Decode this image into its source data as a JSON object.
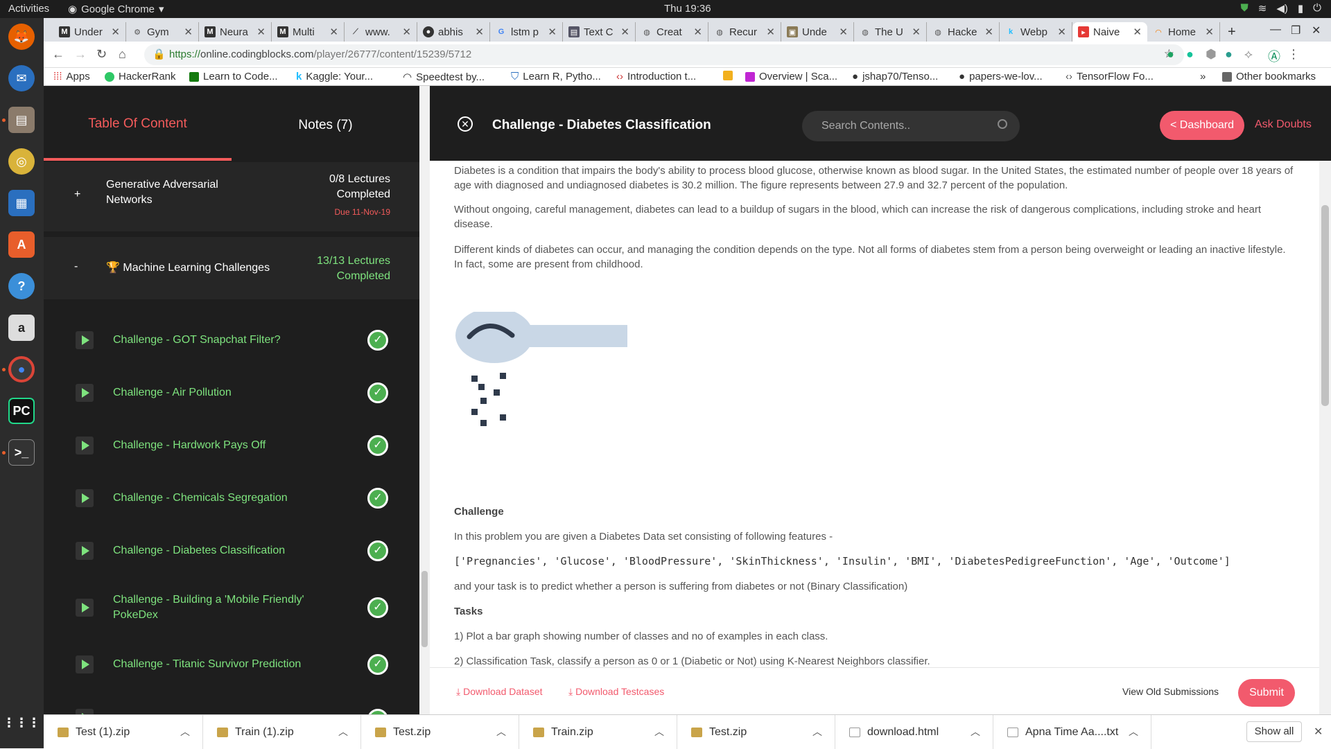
{
  "system": {
    "activities": "Activities",
    "app_name": "Google Chrome",
    "clock": "Thu 19:36"
  },
  "tabs": [
    {
      "label": "Under",
      "icon": "M"
    },
    {
      "label": "Gym",
      "icon": "gear"
    },
    {
      "label": "Neura",
      "icon": "M"
    },
    {
      "label": "Multi",
      "icon": "M"
    },
    {
      "label": "www.",
      "icon": "bolt"
    },
    {
      "label": "abhis",
      "icon": "github"
    },
    {
      "label": "lstm p",
      "icon": "G"
    },
    {
      "label": "Text C",
      "icon": "doc"
    },
    {
      "label": "Creat",
      "icon": "globe"
    },
    {
      "label": "Recur",
      "icon": "globe"
    },
    {
      "label": "Unde",
      "icon": "img"
    },
    {
      "label": "The U",
      "icon": "globe"
    },
    {
      "label": "Hacke",
      "icon": "globe"
    },
    {
      "label": "Webp",
      "icon": "k"
    },
    {
      "label": "Naive",
      "icon": "cb"
    },
    {
      "label": "Home",
      "icon": "c"
    }
  ],
  "url": {
    "scheme": "https://",
    "host": "online.codingblocks.com",
    "path": "/player/26777/content/15239/5712"
  },
  "bookmarks": [
    "Apps",
    "HackerRank",
    "Learn to Code...",
    "Kaggle: Your...",
    "Speedtest by...",
    "Learn R, Pytho...",
    "Introduction t...",
    "Overview | Sca...",
    "jshap70/Tenso...",
    "papers-we-lov...",
    "TensorFlow Fo...",
    "»",
    "Other bookmarks"
  ],
  "sidebar": {
    "toc_label": "Table Of Content",
    "notes_label": "Notes (7)",
    "sections": [
      {
        "sign": "+",
        "title": "Generative Adversarial Networks",
        "progress_line1": "0/8 Lectures",
        "progress_line2": "Completed",
        "due": "Due 11-Nov-19"
      },
      {
        "sign": "-",
        "title": "🏆 Machine Learning Challenges",
        "progress_line1": "13/13 Lectures",
        "progress_line2": "Completed"
      }
    ],
    "lectures": [
      "Challenge - GOT Snapchat Filter?",
      "Challenge - Air Pollution",
      "Challenge - Hardwork Pays Off",
      "Challenge - Chemicals Segregation",
      "Challenge - Diabetes Classification",
      "Challenge - Building a 'Mobile Friendly' PokeDex",
      "Challenge - Titanic Survivor Prediction"
    ]
  },
  "header": {
    "title": "Challenge - Diabetes Classification",
    "search_placeholder": "Search Contents..",
    "dashboard_label": "< Dashboard",
    "ask_label": "Ask Doubts"
  },
  "content": {
    "p1": "Diabetes is a condition that impairs the body's ability to process blood glucose, otherwise known as blood sugar. In the United States, the estimated number of people over 18 years of age with diagnosed and undiagnosed diabetes is 30.2 million. The figure represents between 27.9 and 32.7 percent of the population.",
    "p2": "Without ongoing, careful management, diabetes can lead to a buildup of sugars in the blood, which can increase the risk of dangerous complications, including stroke and heart disease.",
    "p3": "Different kinds of diabetes can occur, and managing the condition depends on the type. Not all forms of diabetes stem from a person being overweight or leading an inactive lifestyle. In fact, some are present from childhood.",
    "challenge_heading": "Challenge",
    "challenge_intro": "In this problem you are given a Diabetes Data set consisting of following features -",
    "features": "['Pregnancies', 'Glucose', 'BloodPressure', 'SkinThickness', 'Insulin', 'BMI', 'DiabetesPedigreeFunction', 'Age', 'Outcome']",
    "task_text": "and your task is to predict whether a person is suffering from diabetes or not (Binary Classification)",
    "tasks_heading": "Tasks",
    "task1": "1) Plot a bar graph showing number of classes and no of examples in each class.",
    "task2": "2) Classification Task, classify a person as 0 or 1 (Diabetic or Not) using K-Nearest Neighbors classifier."
  },
  "footer": {
    "download_dataset": "Download Dataset",
    "download_testcases": "Download Testcases",
    "old_submissions": "View Old Submissions",
    "submit": "Submit"
  },
  "downloads": {
    "items": [
      "Test (1).zip",
      "Train (1).zip",
      "Test.zip",
      "Train.zip",
      "Test.zip",
      "download.html",
      "Apna Time Aa....txt"
    ],
    "show_all": "Show all"
  },
  "colors": {
    "accent": "#f25a6d",
    "completed_green": "#7ee37e",
    "sidebar_bg": "#1e1e1e"
  }
}
